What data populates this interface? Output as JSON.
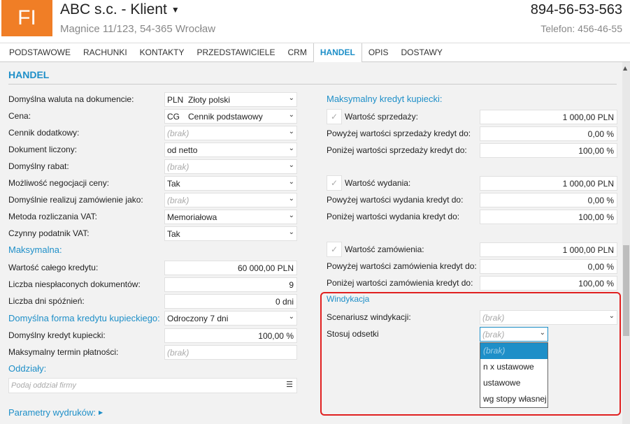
{
  "header": {
    "logo": "FI",
    "title": "ABC s.c. - Klient",
    "address": "Magnice 11/123, 54-365 Wrocław",
    "phone": "894-56-53-563",
    "phone2": "Telefon: 456-46-55"
  },
  "tabs": [
    "PODSTAWOWE",
    "RACHUNKI",
    "KONTAKTY",
    "PRZEDSTAWICIELE",
    "CRM",
    "HANDEL",
    "OPIS",
    "DOSTAWY"
  ],
  "active_tab": "HANDEL",
  "section_title": "HANDEL",
  "left": {
    "rows": [
      {
        "label": "Domyślna waluta na dokumencie:",
        "code": "PLN",
        "value": "Złoty polski"
      },
      {
        "label": "Cena:",
        "code": "CG",
        "value": "Cennik podstawowy"
      },
      {
        "label": "Cennik dodatkowy:",
        "placeholder": "(brak)"
      },
      {
        "label": "Dokument liczony:",
        "value": "od netto"
      },
      {
        "label": "Domyślny rabat:",
        "placeholder": "(brak)"
      },
      {
        "label": "Możliwość negocjacji ceny:",
        "value": "Tak"
      },
      {
        "label": "Domyślnie realizuj zamówienie jako:",
        "placeholder": "(brak)"
      },
      {
        "label": "Metoda rozliczania VAT:",
        "value": "Memoriałowa"
      },
      {
        "label": "Czynny podatnik VAT:",
        "value": "Tak"
      }
    ],
    "maks_header": "Maksymalna:",
    "credit_total_label": "Wartość całego kredytu:",
    "credit_total_value": "60 000,00 PLN",
    "unpaid_docs_label": "Liczba niespłaconych dokumentów:",
    "unpaid_docs_value": "9",
    "days_late_label": "Liczba dni spóźnień:",
    "days_late_value": "0  dni",
    "credit_form_label": "Domyślna forma kredytu kupieckiego:",
    "credit_form_value": "Odroczony 7 dni",
    "default_credit_label": "Domyślny kredyt kupiecki:",
    "default_credit_value": "100,00 %",
    "max_term_label": "Maksymalny termin płatności:",
    "max_term_placeholder": "(brak)",
    "branches_header": "Oddziały:",
    "branches_placeholder": "Podaj oddział firmy",
    "print_params": "Parametry wydruków:"
  },
  "right": {
    "max_credit_header": "Maksymalny kredyt kupiecki:",
    "groups": [
      {
        "check_label": "Wartość sprzedaży:",
        "check_value": "1 000,00 PLN",
        "above_label": "Powyżej wartości sprzedaży kredyt do:",
        "above_value": "0,00 %",
        "below_label": "Poniżej wartości sprzedaży kredyt do:",
        "below_value": "100,00 %"
      },
      {
        "check_label": "Wartość wydania:",
        "check_value": "1 000,00 PLN",
        "above_label": "Powyżej wartości wydania kredyt do:",
        "above_value": "0,00 %",
        "below_label": "Poniżej wartości wydania kredyt do:",
        "below_value": "100,00 %"
      },
      {
        "check_label": "Wartość zamówienia:",
        "check_value": "1 000,00 PLN",
        "above_label": "Powyżej wartości zamówienia kredyt do:",
        "above_value": "0,00 %",
        "below_label": "Poniżej wartości zamówienia kredyt do:",
        "below_value": "100,00 %"
      }
    ],
    "windykacja_header": "Windykacja",
    "scenario_label": "Scenariusz windykacji:",
    "scenario_placeholder": "(brak)",
    "interest_label": "Stosuj odsetki",
    "interest_placeholder": "(brak)",
    "interest_options": [
      "(brak)",
      "n x ustawowe",
      "ustawowe",
      "wg stopy własnej"
    ]
  },
  "colors": {
    "accent": "#1e8fc8",
    "logo": "#f07e26",
    "highlight_box": "#e02020"
  }
}
